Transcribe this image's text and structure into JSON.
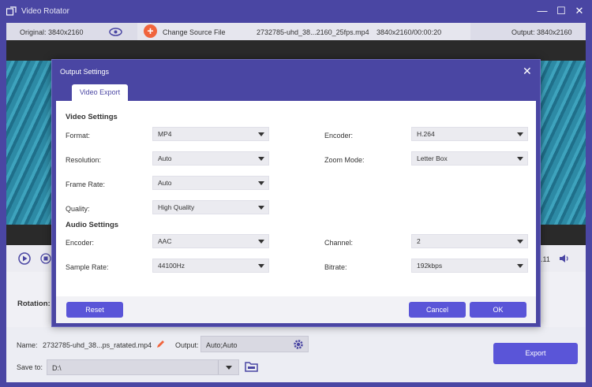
{
  "app": {
    "title": "Video Rotator"
  },
  "info": {
    "original": "Original: 3840x2160",
    "change_source": "Change Source File",
    "filename": "2732785-uhd_38...2160_25fps.mp4",
    "dims_duration": "3840x2160/00:00:20",
    "output": "Output: 3840x2160"
  },
  "controls": {
    "time_partial": "0.11"
  },
  "rotation": {
    "label": "Rotation:"
  },
  "bottom": {
    "name_label": "Name:",
    "name_value": "2732785-uhd_38...ps_ratated.mp4",
    "output_label": "Output:",
    "output_value": "Auto;Auto",
    "save_label": "Save to:",
    "save_value": "D:\\",
    "export": "Export"
  },
  "dialog": {
    "title": "Output Settings",
    "tab": "Video Export",
    "video_section": "Video Settings",
    "audio_section": "Audio Settings",
    "format_label": "Format:",
    "format_value": "MP4",
    "encoder_label": "Encoder:",
    "encoder_value": "H.264",
    "resolution_label": "Resolution:",
    "resolution_value": "Auto",
    "zoom_label": "Zoom Mode:",
    "zoom_value": "Letter Box",
    "framerate_label": "Frame Rate:",
    "framerate_value": "Auto",
    "quality_label": "Quality:",
    "quality_value": "High Quality",
    "aencoder_label": "Encoder:",
    "aencoder_value": "AAC",
    "channel_label": "Channel:",
    "channel_value": "2",
    "samplerate_label": "Sample Rate:",
    "samplerate_value": "44100Hz",
    "bitrate_label": "Bitrate:",
    "bitrate_value": "192kbps",
    "reset": "Reset",
    "cancel": "Cancel",
    "ok": "OK"
  },
  "colors": {
    "brand": "#4a46a3",
    "button": "#5a55d8",
    "accent_orange": "#f0643c"
  }
}
